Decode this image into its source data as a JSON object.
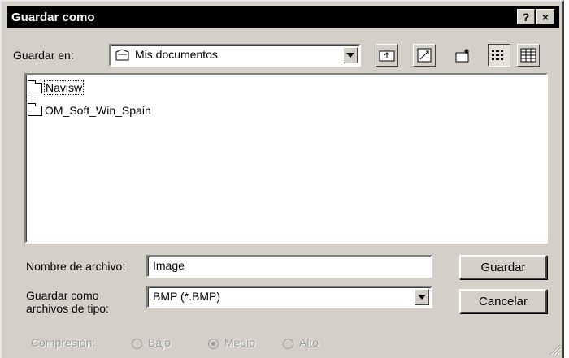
{
  "window": {
    "title": "Guardar como",
    "help_label": "?",
    "close_label": "×"
  },
  "location": {
    "label": "Guardar en:",
    "value": "Mis documentos",
    "icon": "folder-open-icon"
  },
  "toolbar": {
    "up_folder": "up-one-level-icon",
    "desktop": "desktop-icon",
    "new_folder": "new-folder-icon",
    "list_view": "list-view-icon",
    "details_view": "details-view-icon"
  },
  "files": {
    "items": [
      {
        "name": "Navisw"
      },
      {
        "name": "OM_Soft_Win_Spain"
      }
    ]
  },
  "filename": {
    "label": "Nombre de archivo:",
    "value": "Image"
  },
  "filetype": {
    "label_line1": "Guardar como",
    "label_line2": "archivos de tipo:",
    "value": "BMP (*.BMP)"
  },
  "buttons": {
    "save": "Guardar",
    "cancel": "Cancelar"
  },
  "compression": {
    "label": "Compresión:",
    "options": [
      {
        "label": "Bajo",
        "checked": false
      },
      {
        "label": "Medio",
        "checked": true
      },
      {
        "label": "Alto",
        "checked": false
      }
    ]
  }
}
